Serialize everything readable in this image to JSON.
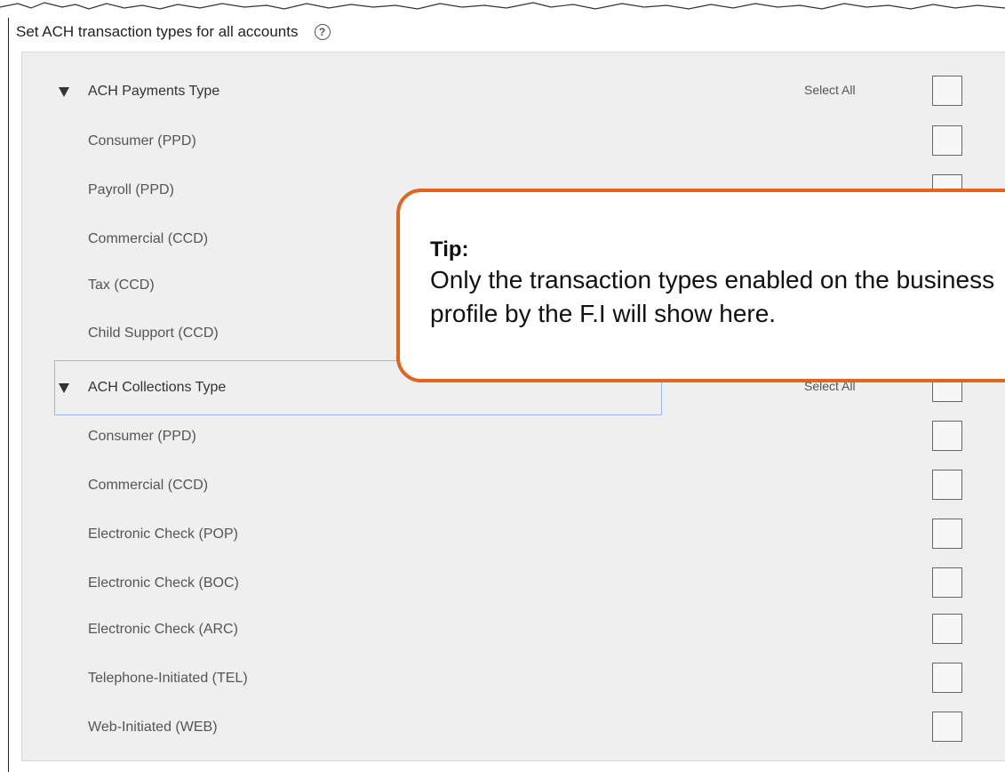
{
  "header": {
    "title": "Set ACH transaction types for all accounts",
    "help_icon": "question-circle-icon"
  },
  "groups": [
    {
      "title": "ACH Payments Type",
      "select_all_label": "Select All",
      "items": [
        {
          "label": "Consumer (PPD)",
          "checked": false
        },
        {
          "label": "Payroll (PPD)",
          "checked": false
        },
        {
          "label": "Commercial (CCD)",
          "checked": false
        },
        {
          "label": "Tax (CCD)",
          "checked": false
        },
        {
          "label": "Child Support (CCD)",
          "checked": false
        }
      ]
    },
    {
      "title": "ACH Collections Type",
      "select_all_label": "Select All",
      "items": [
        {
          "label": "Consumer (PPD)",
          "checked": false
        },
        {
          "label": "Commercial (CCD)",
          "checked": false
        },
        {
          "label": "Electronic Check (POP)",
          "checked": false
        },
        {
          "label": "Electronic Check (BOC)",
          "checked": false
        },
        {
          "label": "Electronic Check (ARC)",
          "checked": false
        },
        {
          "label": "Telephone-Initiated (TEL)",
          "checked": false
        },
        {
          "label": "Web-Initiated (WEB)",
          "checked": false
        }
      ]
    }
  ],
  "tip": {
    "title": "Tip:",
    "body": "Only the transaction types enabled on the business profile by the F.I will show here."
  },
  "colors": {
    "panel_background": "#efefef",
    "tip_border": "#e3641b",
    "focus_outline": "#9bb8e8"
  }
}
